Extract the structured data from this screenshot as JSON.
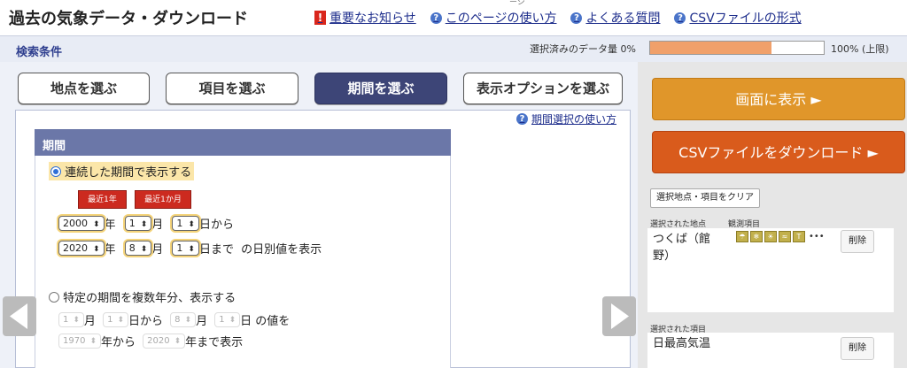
{
  "header": {
    "title": "過去の気象データ・ダウンロード",
    "top_fragment": "ーシ",
    "links": [
      {
        "label": "重要なお知らせ",
        "icon": "exclamation-icon"
      },
      {
        "label": "このページの使い方",
        "icon": "question-icon"
      },
      {
        "label": "よくある質問",
        "icon": "question-icon"
      },
      {
        "label": "CSVファイルの形式",
        "icon": "question-icon"
      }
    ]
  },
  "search_bar": {
    "label": "検索条件",
    "data_amount_label": "選択済みのデータ量 0%",
    "limit_label": "100% (上限)",
    "progress_fraction": 0.7
  },
  "tabs": [
    {
      "label": "地点を選ぶ",
      "active": false
    },
    {
      "label": "項目を選ぶ",
      "active": false
    },
    {
      "label": "期間を選ぶ",
      "active": true
    },
    {
      "label": "表示オプションを選ぶ",
      "active": false
    }
  ],
  "period": {
    "usage_link": "期間選択の使い方",
    "section_title": "期間",
    "option1_label": "連続した期間で表示する",
    "quick": {
      "last_year": "最近1年",
      "last_month": "最近1か月"
    },
    "start": {
      "year": "2000",
      "month": "1",
      "day": "1"
    },
    "end": {
      "year": "2020",
      "month": "8",
      "day": "1"
    },
    "labels": {
      "year": "年",
      "month": "月",
      "from_day": "日から",
      "to_day": "日まで",
      "daily_suffix": "の日別値を表示"
    },
    "option2_label": "特定の期間を複数年分、表示する",
    "multi": {
      "start_month": "1",
      "start_day": "1",
      "end_month": "8",
      "end_day": "1",
      "start_year": "1970",
      "end_year": "2020",
      "month_label": "月",
      "from_day_label": "日から",
      "day_values_label": "日 の値を",
      "year_from_label": "年から",
      "year_to_label": "年まで表示"
    }
  },
  "side": {
    "show_button": "画面に表示 ►",
    "csv_button": "CSVファイルをダウンロード ►",
    "clear_button": "選択地点・項目をクリア",
    "selected_stations_label": "選択された地点",
    "observed_items_label": "観測項目",
    "station_name": "つくば（館野）",
    "station_icons": [
      "rain-icon",
      "snow-icon",
      "sun-icon",
      "wind-icon",
      "temperature-icon"
    ],
    "more_icons": "•••",
    "delete_label": "削除",
    "selected_items_label": "選択された項目",
    "item_name": "日最高気温"
  }
}
